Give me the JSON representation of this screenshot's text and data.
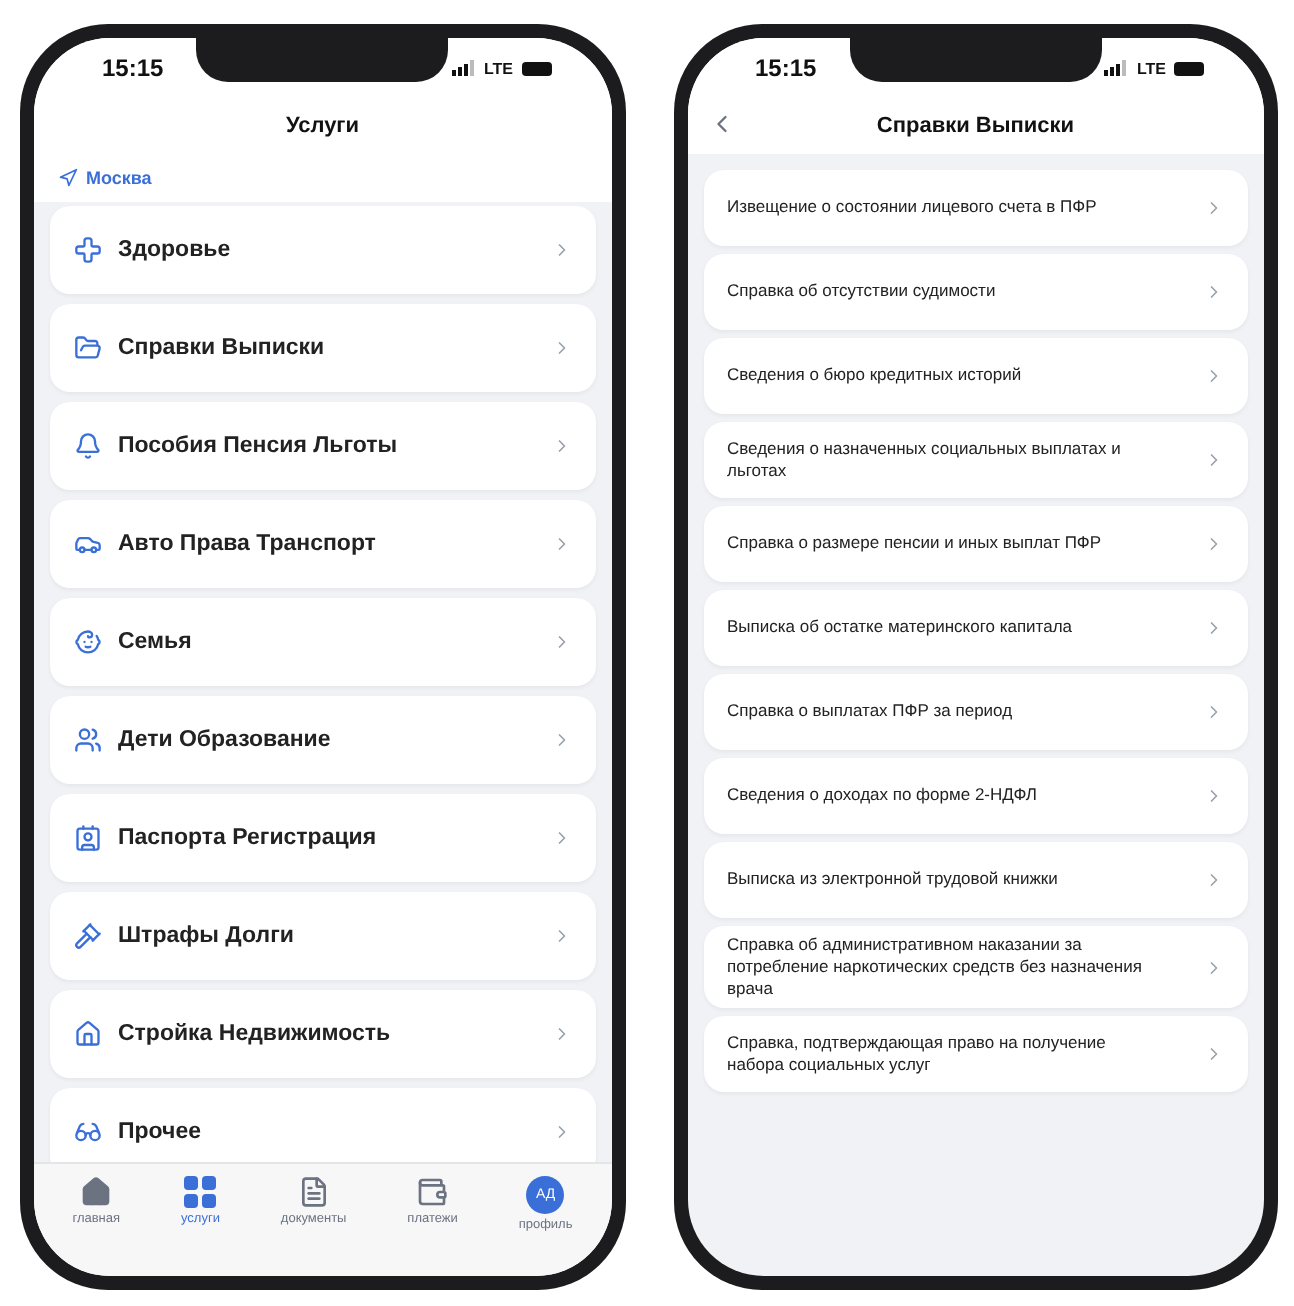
{
  "phones": [
    {
      "status_bar": {
        "time": "15:15",
        "network": "LTE"
      },
      "title": "Услуги",
      "location": "Москва",
      "categories": [
        {
          "label": "Здоровье"
        },
        {
          "label": "Справки Выписки"
        },
        {
          "label": "Пособия Пенсия Льготы"
        },
        {
          "label": "Авто Права Транспорт"
        },
        {
          "label": "Семья"
        },
        {
          "label": "Дети Образование"
        },
        {
          "label": "Паспорта Регистрация"
        },
        {
          "label": "Штрафы Долги"
        },
        {
          "label": "Стройка Недвижимость"
        },
        {
          "label": "Прочее"
        }
      ],
      "tab_bar": [
        {
          "kind": "home",
          "label": "главная",
          "selected": false
        },
        {
          "kind": "services",
          "label": "услуги",
          "selected": true
        },
        {
          "kind": "documents",
          "label": "документы",
          "selected": false
        },
        {
          "kind": "payments",
          "label": "платежи",
          "selected": false
        },
        {
          "kind": "profile",
          "label": "профиль",
          "selected": false,
          "avatar": "АД"
        }
      ]
    },
    {
      "status_bar": {
        "time": "15:15",
        "network": "LTE"
      },
      "title": "Справки Выписки",
      "items": [
        "Извещение о состоянии лицевого счета в ПФР",
        "Справка об отсутствии судимости",
        "Сведения о бюро кредитных историй",
        "Сведения о назначенных социальных выплатах и льготах",
        "Справка о размере пенсии и иных выплат ПФР",
        "Выписка об остатке материнского капитала",
        "Справка о выплатах ПФР за период",
        "Сведения о доходах по форме 2-НДФЛ",
        "Выписка из электронной трудовой книжки",
        "Справка об административном наказании за потребление наркотических средств без назначения врача",
        "Справка, подтверждающая право на получение набора социальных услуг"
      ]
    }
  ]
}
